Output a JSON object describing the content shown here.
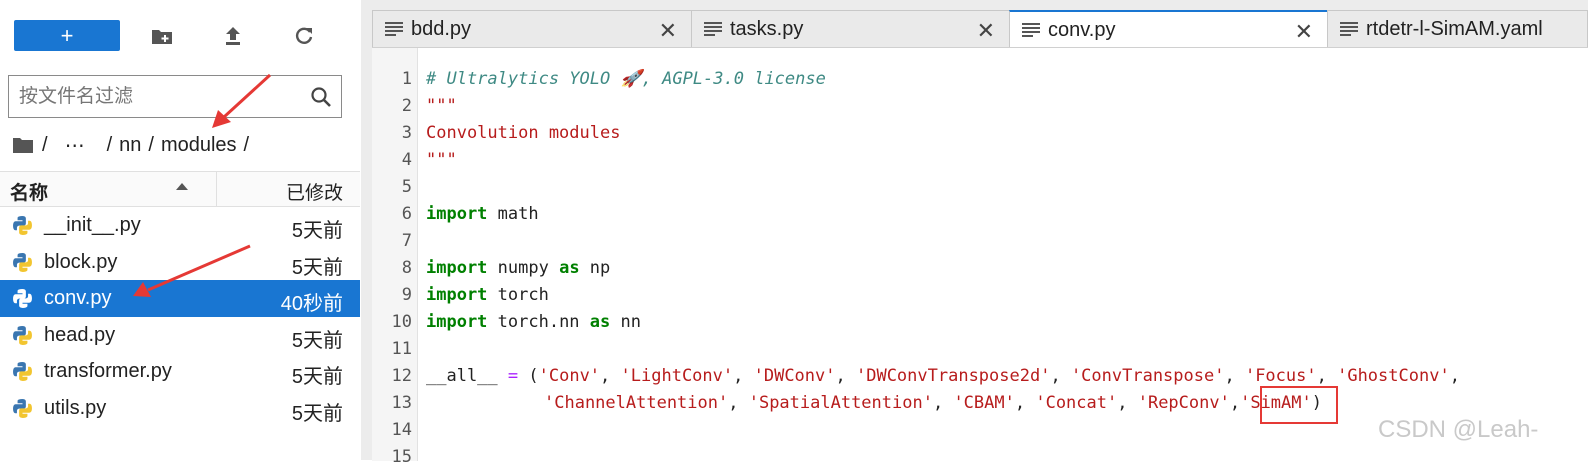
{
  "toolbar": {
    "new_label": "+"
  },
  "filter": {
    "placeholder": "按文件名过滤"
  },
  "breadcrumb": {
    "sep": "/",
    "ellipsis": "⋯",
    "path1": "nn",
    "path2": "modules"
  },
  "file_list": {
    "col_name": "名称",
    "col_modified": "已修改",
    "files": [
      {
        "name": "__init__.py",
        "modified": "5天前"
      },
      {
        "name": "block.py",
        "modified": "5天前"
      },
      {
        "name": "conv.py",
        "modified": "40秒前"
      },
      {
        "name": "head.py",
        "modified": "5天前"
      },
      {
        "name": "transformer.py",
        "modified": "5天前"
      },
      {
        "name": "utils.py",
        "modified": "5天前"
      }
    ]
  },
  "tabs": [
    {
      "label": "bdd.py"
    },
    {
      "label": "tasks.py"
    },
    {
      "label": "conv.py"
    },
    {
      "label": "rtdetr-l-SimAM.yaml"
    }
  ],
  "tab_close": "✕",
  "line_numbers": [
    "1",
    "2",
    "3",
    "4",
    "5",
    "6",
    "7",
    "8",
    "9",
    "10",
    "11",
    "12",
    "13",
    "14",
    "15"
  ],
  "code": {
    "l1": "# Ultralytics YOLO 🚀, AGPL-3.0 license",
    "l2": "\"\"\"",
    "l3": "Convolution modules",
    "l4": "\"\"\"",
    "l6_kw": "import",
    "l6_rest": " math",
    "l8_kw1": "import",
    "l8_mid": " numpy ",
    "l8_kw2": "as",
    "l8_end": " np",
    "l9_kw": "import",
    "l9_rest": " torch",
    "l10_kw1": "import",
    "l10_mid": " torch.nn ",
    "l10_kw2": "as",
    "l10_end": " nn",
    "l12_name": "__all__",
    "l12_eq": " = ",
    "l12_open": "(",
    "l12_items": [
      "'Conv'",
      "'LightConv'",
      "'DWConv'",
      "'DWConvTranspose2d'",
      "'ConvTranspose'",
      "'Focus'",
      "'GhostConv'"
    ],
    "l13_items": [
      "'ChannelAttention'",
      "'SpatialAttention'",
      "'CBAM'",
      "'Concat'",
      "'RepConv'",
      "'SimAM'"
    ],
    "l13_close": ")",
    "comma": ", ",
    "trailing_comma": ","
  },
  "watermark": "CSDN @Leah-",
  "colors": {
    "accent": "#1976d2",
    "annotation": "#e53935",
    "comment": "#3f8a84",
    "string": "#b71c1c",
    "keyword": "#008000"
  }
}
